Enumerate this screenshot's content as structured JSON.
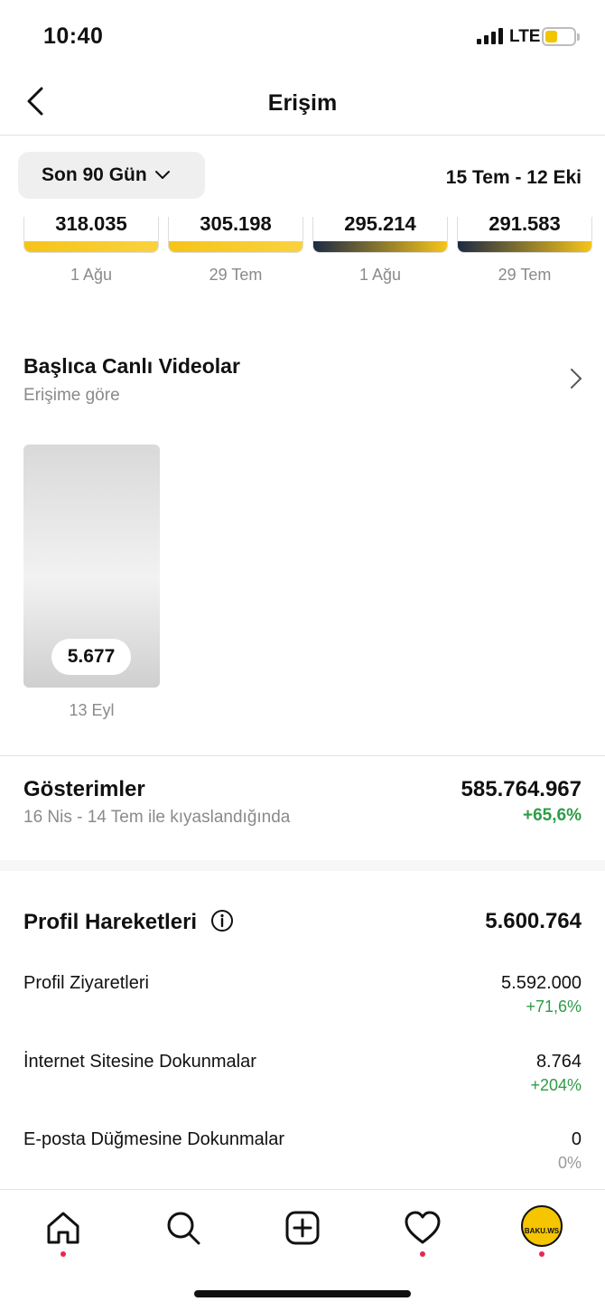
{
  "status_bar": {
    "time": "10:40",
    "network": "LTE"
  },
  "nav": {
    "title": "Erişim"
  },
  "filter": {
    "range_label": "Son 90 Gün",
    "date_range": "15 Tem - 12 Eki"
  },
  "thumbnails": [
    {
      "value": "318.035",
      "date": "1 Ağu"
    },
    {
      "value": "305.198",
      "date": "29 Tem"
    },
    {
      "value": "295.214",
      "date": "1 Ağu"
    },
    {
      "value": "291.583",
      "date": "29 Tem"
    }
  ],
  "live_videos": {
    "title": "Başlıca Canlı Videolar",
    "subtitle": "Erişime göre",
    "items": [
      {
        "value": "5.677",
        "date": "13 Eyl"
      }
    ]
  },
  "impressions": {
    "label": "Gösterimler",
    "comparison": "16 Nis - 14 Tem ile kıyaslandığında",
    "value": "585.764.967",
    "change": "+65,6%"
  },
  "profile_activity": {
    "label": "Profil Hareketleri",
    "value": "5.600.764",
    "rows": [
      {
        "label": "Profil Ziyaretleri",
        "value": "5.592.000",
        "change": "+71,6%"
      },
      {
        "label": "İnternet Sitesine Dokunmalar",
        "value": "8.764",
        "change": "+204%"
      },
      {
        "label": "E-posta Düğmesine Dokunmalar",
        "value": "0",
        "change": "0%"
      }
    ]
  },
  "tabbar": {
    "icons": [
      "home-icon",
      "search-icon",
      "create-icon",
      "activity-icon",
      "profile-avatar"
    ],
    "avatar_text": "BAKU.WS"
  },
  "colors": {
    "positive": "#2e9c46",
    "accent_yellow": "#f5c500",
    "notification_dot": "#e8264c"
  }
}
